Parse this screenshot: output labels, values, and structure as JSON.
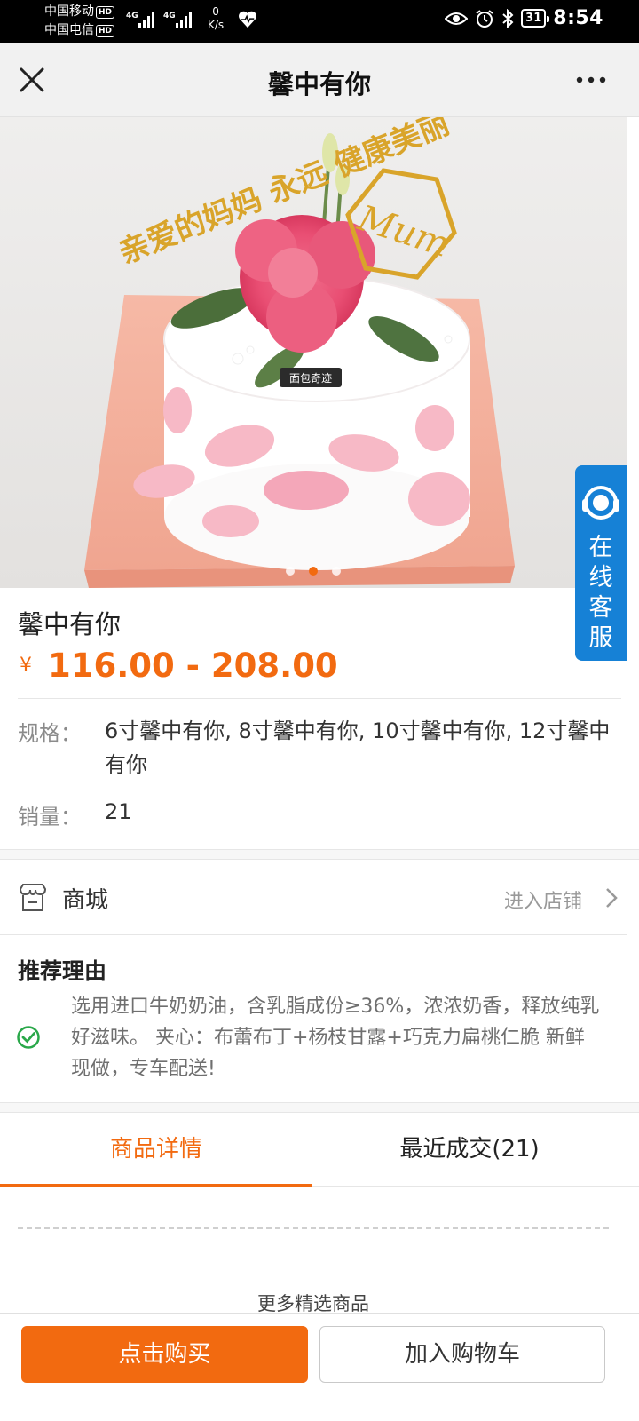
{
  "status_bar": {
    "carrier_1": "中国移动",
    "carrier_2": "中国电信",
    "hd_badge": "HD",
    "network_label": "4G",
    "speed_value": "0",
    "speed_unit": "K/s",
    "battery": "31",
    "time": "8:54"
  },
  "nav": {
    "title": "馨中有你"
  },
  "hero": {
    "slide_count": 3,
    "active_slide": 2,
    "cake_topper_left": "亲爱的妈妈 永远 健康美丽",
    "cake_topper_right": "Mum",
    "cake_brand": "面包奇迹"
  },
  "service": {
    "label": "在线客服"
  },
  "product": {
    "name": "馨中有你",
    "currency": "¥",
    "price_range": "116.00 - 208.00",
    "spec_label": "规格：",
    "spec_value": "6寸馨中有你, 8寸馨中有你, 10寸馨中有你, 12寸馨中有你",
    "sales_label": "销量：",
    "sales_value": "21"
  },
  "store": {
    "name": "商城",
    "enter_label": "进入店铺"
  },
  "reason": {
    "title": "推荐理由",
    "text": "选用进口牛奶奶油，含乳脂成份≥36%，浓浓奶香，释放纯乳好滋味。 夹心：布蕾布丁+杨枝甘露+巧克力扁桃仁脆 新鲜现做，专车配送!"
  },
  "tabs": {
    "details": "商品详情",
    "recent": "最近成交(21)"
  },
  "more_goods": "更多精选商品",
  "actions": {
    "buy": "点击购买",
    "add_cart": "加入购物车"
  },
  "colors": {
    "accent": "#f26a10",
    "service_blue": "#1681d6",
    "check_green": "#2aa84a"
  }
}
